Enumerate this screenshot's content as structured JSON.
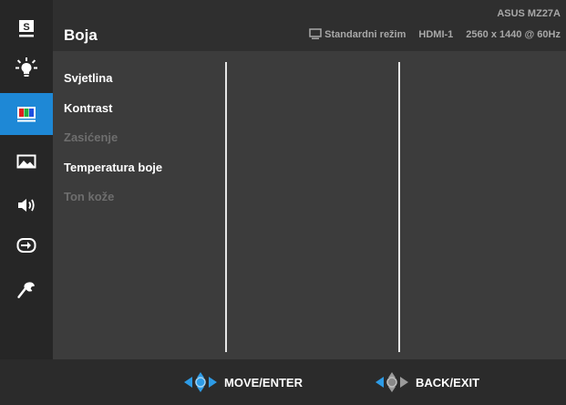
{
  "sidebar": {
    "items": [
      {
        "icon": "splendid-icon",
        "active": false
      },
      {
        "icon": "brightness-icon",
        "active": false
      },
      {
        "icon": "color-icon",
        "active": true
      },
      {
        "icon": "image-icon",
        "active": false
      },
      {
        "icon": "sound-icon",
        "active": false
      },
      {
        "icon": "input-select-icon",
        "active": false
      },
      {
        "icon": "system-setup-icon",
        "active": false
      }
    ],
    "splendid_letter": "S"
  },
  "header": {
    "title": "Boja",
    "model": "ASUS MZ27A",
    "mode": "Standardni režim",
    "input": "HDMI-1",
    "resolution": "2560 x 1440 @ 60Hz"
  },
  "menu": {
    "items": [
      {
        "label": "Svjetlina",
        "enabled": true
      },
      {
        "label": "Kontrast",
        "enabled": true
      },
      {
        "label": "Zasićenje",
        "enabled": false
      },
      {
        "label": "Temperatura boje",
        "enabled": true
      },
      {
        "label": "Ton kože",
        "enabled": false
      }
    ]
  },
  "footer": {
    "move_label": "MOVE/ENTER",
    "back_label": "BACK/EXIT"
  },
  "colors": {
    "accent": "#1e88d6",
    "panel": "#3c3c3c",
    "sidebar": "#262626",
    "text": "#ffffff",
    "disabled_text": "#6e6e6e"
  }
}
